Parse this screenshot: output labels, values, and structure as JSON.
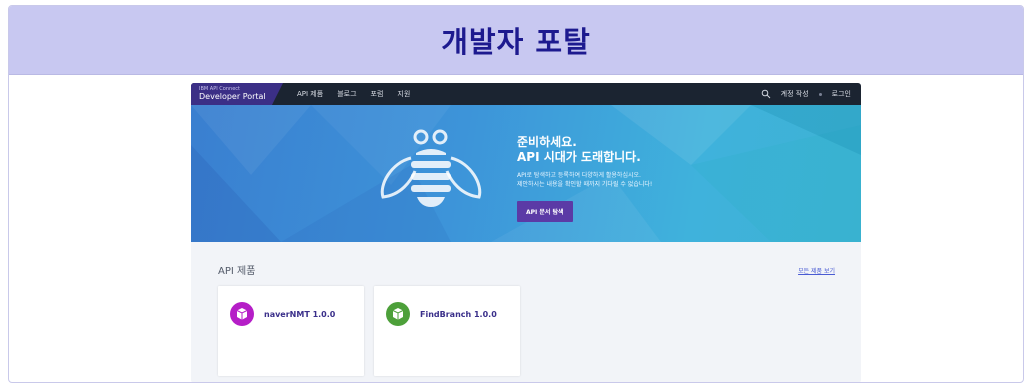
{
  "frame": {
    "title": "개발자 포탈"
  },
  "portal": {
    "brand": {
      "small": "IBM API Connect",
      "name": "Developer Portal"
    },
    "nav": [
      "API 제품",
      "블로그",
      "포럼",
      "지원"
    ],
    "nav_right": {
      "create_account": "계정 작성",
      "login": "로그인"
    },
    "hero": {
      "title_line1": "준비하세요.",
      "title_line2": "API 시대가 도래합니다.",
      "desc_line1": "API로 탐색하고 등록하여 다양하게 활용하십시오.",
      "desc_line2": "제안하시는 내용을 확인할 때까지 기다릴 수 없습니다!",
      "button": "API 문서 탐색"
    },
    "products": {
      "title": "API 제품",
      "see_all": "모든 제품 보기",
      "items": [
        {
          "name": "naverNMT 1.0.0",
          "color": "#b51ec7"
        },
        {
          "name": "FindBranch 1.0.0",
          "color": "#4da03a"
        }
      ]
    }
  }
}
